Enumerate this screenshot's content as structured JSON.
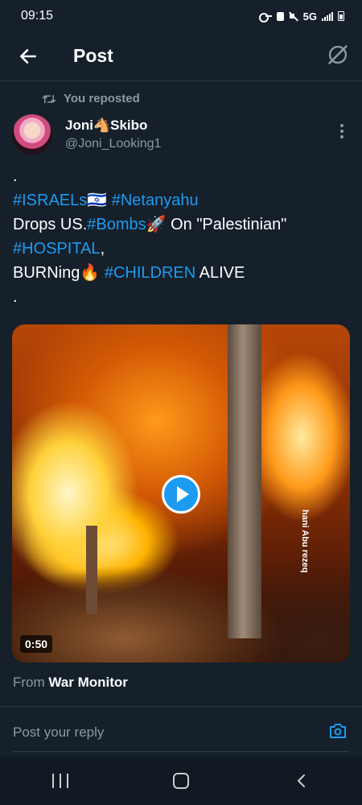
{
  "status_bar": {
    "time": "09:15",
    "network": "5G",
    "icons": [
      "key-icon",
      "lock-icon",
      "mute-icon",
      "signal-icon",
      "battery-icon"
    ]
  },
  "header": {
    "title": "Post",
    "back_icon": "arrow-left-icon",
    "right_icon": "grok-icon"
  },
  "repost": {
    "label": "You reposted",
    "icon": "retweet-icon"
  },
  "author": {
    "display_name": "Joni🐴Skibo",
    "handle": "@Joni_Looking1"
  },
  "tweet": {
    "line1": ".",
    "line2": [
      {
        "text": " #ISRAELs🇮🇱 #Netanyahu",
        "hashtag": true
      }
    ],
    "line3": [
      {
        "text": "Drops US.",
        "hashtag": false
      },
      {
        "text": "#Bombs",
        "hashtag": true
      },
      {
        "text": "🚀  On  \"Palestinian\"",
        "hashtag": false
      }
    ],
    "line4": [
      {
        "text": "#HOSPITAL",
        "hashtag": true
      },
      {
        "text": ",",
        "hashtag": false
      }
    ],
    "line5": [
      {
        "text": "BURNing🔥 ",
        "hashtag": false
      },
      {
        "text": "#CHILDREN",
        "hashtag": true
      },
      {
        "text": " ALIVE",
        "hashtag": false
      }
    ],
    "line6": "."
  },
  "media": {
    "duration": "0:50",
    "watermark": "hani Abu rezeq"
  },
  "source": {
    "prefix": "From ",
    "name": "War Monitor"
  },
  "reply": {
    "placeholder": "Post your reply",
    "icon": "camera-icon"
  },
  "colors": {
    "background": "#15202b",
    "accent": "#1d9bf0",
    "secondary_text": "#8b98a5"
  }
}
